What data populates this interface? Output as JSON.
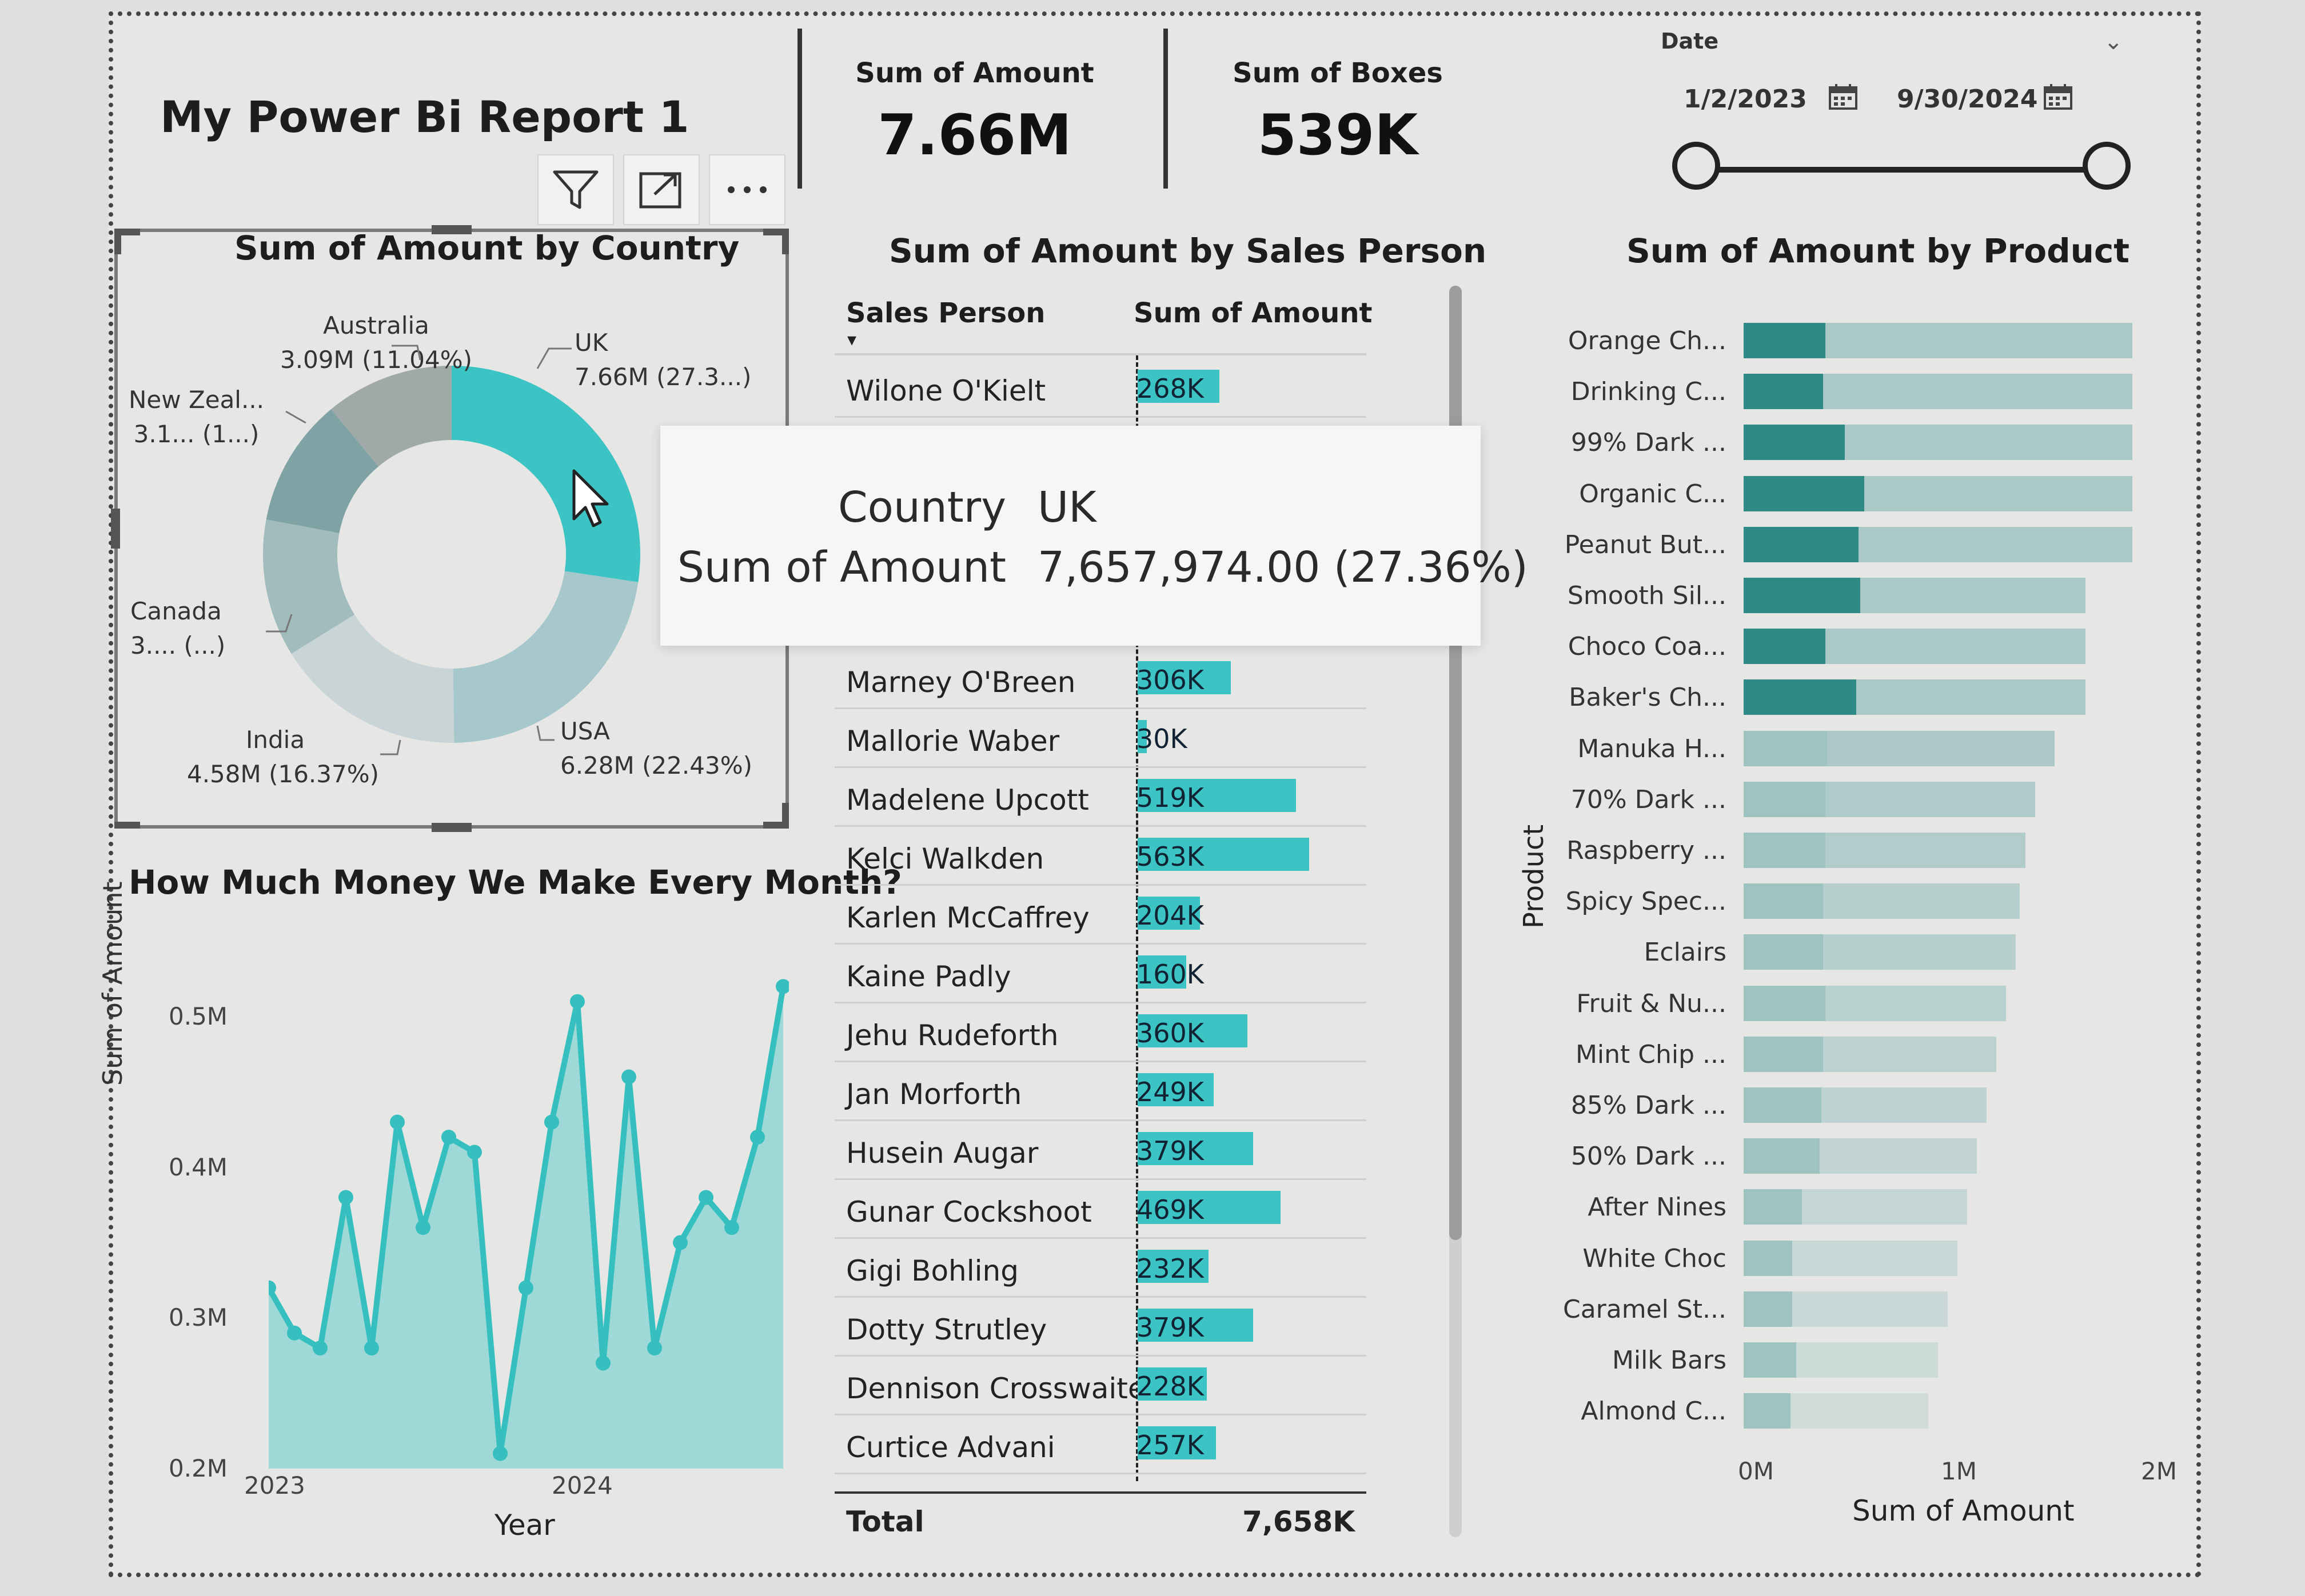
{
  "report": {
    "title": "My Power Bi Report 1"
  },
  "kpis": [
    {
      "label": "Sum of Amount",
      "value": "7.66M"
    },
    {
      "label": "Sum of Boxes",
      "value": "539K"
    }
  ],
  "date_slicer": {
    "title": "Date",
    "start": "1/2/2023",
    "end": "9/30/2024"
  },
  "donut": {
    "title": "Sum of Amount by Country",
    "labels": {
      "australia": [
        "Australia",
        "3.09M (11.04%)"
      ],
      "uk": [
        "UK",
        "7.66M (27.3...)"
      ],
      "newzealand": [
        "New Zeal...",
        "3.1... (1...)"
      ],
      "canada": [
        "Canada",
        "3.... (...)"
      ],
      "india": [
        "India",
        "4.58M (16.37%)"
      ],
      "usa": [
        "USA",
        "6.28M (22.43%)"
      ]
    }
  },
  "tooltip": {
    "country_key": "Country",
    "country_val": "UK",
    "amount_key": "Sum of Amount",
    "amount_val": "7,657,974.00 (27.36%)"
  },
  "sales_table": {
    "title": "Sum of Amount by Sales Person",
    "col_person": "Sales Person",
    "col_amount": "Sum of Amount",
    "rows": [
      {
        "name": "Wilone O'Kielt",
        "value": "268K",
        "amount": 268
      },
      {
        "name": "Marney O'Breen",
        "value": "306K",
        "amount": 306
      },
      {
        "name": "Mallorie Waber",
        "value": "30K",
        "amount": 30
      },
      {
        "name": "Madelene Upcott",
        "value": "519K",
        "amount": 519
      },
      {
        "name": "Kelci Walkden",
        "value": "563K",
        "amount": 563
      },
      {
        "name": "Karlen McCaffrey",
        "value": "204K",
        "amount": 204
      },
      {
        "name": "Kaine Padly",
        "value": "160K",
        "amount": 160
      },
      {
        "name": "Jehu Rudeforth",
        "value": "360K",
        "amount": 360
      },
      {
        "name": "Jan Morforth",
        "value": "249K",
        "amount": 249
      },
      {
        "name": "Husein Augar",
        "value": "379K",
        "amount": 379
      },
      {
        "name": "Gunar Cockshoot",
        "value": "469K",
        "amount": 469
      },
      {
        "name": "Gigi Bohling",
        "value": "232K",
        "amount": 232
      },
      {
        "name": "Dotty Strutley",
        "value": "379K",
        "amount": 379
      },
      {
        "name": "Dennison Crosswaite",
        "value": "228K",
        "amount": 228
      },
      {
        "name": "Curtice Advani",
        "value": "257K",
        "amount": 257
      }
    ],
    "total_label": "Total",
    "total_value": "7,658K"
  },
  "chart_data": [
    {
      "type": "area",
      "title": "How Much Money We Make Every Month?",
      "xlabel": "Year",
      "ylabel": "Sum of Amount",
      "x_ticks": [
        "2023",
        "2024"
      ],
      "y_ticks": [
        "0.2M",
        "0.3M",
        "0.4M",
        "0.5M"
      ],
      "ylim": [
        0.2,
        0.53
      ],
      "values": [
        0.32,
        0.29,
        0.28,
        0.38,
        0.28,
        0.43,
        0.36,
        0.42,
        0.41,
        0.21,
        0.32,
        0.43,
        0.51,
        0.27,
        0.46,
        0.28,
        0.35,
        0.38,
        0.36,
        0.42,
        0.52
      ]
    },
    {
      "type": "donut",
      "title": "Sum of Amount by Country",
      "categories": [
        "UK",
        "USA",
        "India",
        "Canada",
        "New Zealand",
        "Australia"
      ],
      "values": [
        27.36,
        22.43,
        16.37,
        11.8,
        11.0,
        11.04
      ],
      "colors": [
        "#3cc4c4",
        "#a6c7cc",
        "#c9d4d6",
        "#a2bcbd",
        "#7fa3a4",
        "#9fa9a8"
      ]
    },
    {
      "type": "bar",
      "title": "Sum of Amount by Product",
      "ylabel": "Product",
      "xlabel": "Sum of Amount",
      "x_ticks": [
        "0M",
        "1M",
        "2M"
      ],
      "categories": [
        "Orange Ch...",
        "Drinking C...",
        "99% Dark ...",
        "Organic C...",
        "Peanut But...",
        "Smooth Sil...",
        "Choco Coa...",
        "Baker's Ch...",
        "Manuka H...",
        "70% Dark ...",
        "Raspberry ...",
        "Spicy Spec...",
        "Eclairs",
        "Fruit & Nu...",
        "Mint Chip ...",
        "85% Dark ...",
        "50% Dark ...",
        "After Nines",
        "White Choc",
        "Caramel St...",
        "Milk Bars",
        "Almond C..."
      ],
      "values": [
        0.42,
        0.41,
        0.52,
        0.62,
        0.59,
        0.6,
        0.42,
        0.58,
        0.43,
        0.42,
        0.42,
        0.41,
        0.41,
        0.42,
        0.41,
        0.4,
        0.39,
        0.3,
        0.25,
        0.25,
        0.27,
        0.24
      ],
      "track": [
        2.0,
        2.0,
        2.0,
        2.0,
        2.0,
        1.76,
        1.76,
        1.76,
        1.6,
        1.5,
        1.45,
        1.42,
        1.4,
        1.35,
        1.3,
        1.25,
        1.2,
        1.15,
        1.1,
        1.05,
        1.0,
        0.95
      ],
      "colors": {
        "fill": "#2f8a85",
        "track": "#a9c8c6"
      }
    }
  ]
}
